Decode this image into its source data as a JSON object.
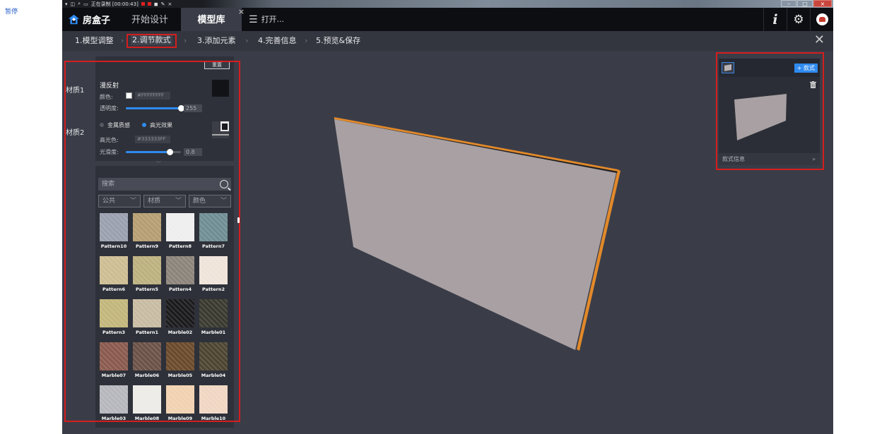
{
  "recorder": {
    "pause_label": "暂停",
    "status": "正在录制 [00:00:43]"
  },
  "app": {
    "logo_text": "房盒子",
    "tabs": [
      {
        "label": "开始设计"
      },
      {
        "label": "模型库"
      }
    ],
    "open_label": "打开..."
  },
  "steps": [
    {
      "label": "1.模型调整"
    },
    {
      "label": "2.调节款式"
    },
    {
      "label": "3.添加元素"
    },
    {
      "label": "4.完善信息"
    },
    {
      "label": "5.预览&保存"
    }
  ],
  "material_tabs": [
    "材质1",
    "材质2"
  ],
  "panel": {
    "reset_label": "重置",
    "diffuse_title": "漫反射",
    "color_label": "颜色:",
    "color_value": "#FFFFFFFF",
    "opacity_label": "透明度:",
    "opacity_value": "255",
    "opacity_fraction": 1.0,
    "metal_label": "金属质感",
    "gloss_label": "高光效果",
    "specular_label": "高光色:",
    "specular_value": "#333333FF",
    "smooth_label": "光滑度:",
    "smooth_value": "0.8",
    "smooth_fraction": 0.8,
    "search_placeholder": "搜索",
    "filters": [
      "公共",
      "材质",
      "颜色"
    ]
  },
  "materials": [
    {
      "label": "Pattern10",
      "color": "#9aa0ad"
    },
    {
      "label": "Pattern9",
      "color": "#b59d72"
    },
    {
      "label": "Pattern8",
      "color": "#eeeeee"
    },
    {
      "label": "Pattern7",
      "color": "#6f8d94"
    },
    {
      "label": "Pattern6",
      "color": "#cdbd92"
    },
    {
      "label": "Pattern5",
      "color": "#bcb07f"
    },
    {
      "label": "Pattern4",
      "color": "#8c847b"
    },
    {
      "label": "Pattern2",
      "color": "#efe4da"
    },
    {
      "label": "Pattern3",
      "color": "#c2b67b"
    },
    {
      "label": "Pattern1",
      "color": "#c8bba3"
    },
    {
      "label": "Marble02",
      "color": "#1b1b1e"
    },
    {
      "label": "Marble01",
      "color": "#3b3a30"
    },
    {
      "label": "Marble07",
      "color": "#8a5a4e"
    },
    {
      "label": "Marble06",
      "color": "#6b5248"
    },
    {
      "label": "Marble05",
      "color": "#6b4a2b"
    },
    {
      "label": "Marble04",
      "color": "#4d4531"
    },
    {
      "label": "Marble03",
      "color": "#b5b7bd"
    },
    {
      "label": "Marble08",
      "color": "#ecebe6"
    },
    {
      "label": "Marble09",
      "color": "#f1d2b0"
    },
    {
      "label": "Marble10",
      "color": "#f0d6c3"
    }
  ],
  "style_panel": {
    "add_label": "+ 款式",
    "info_label": "款式信息"
  },
  "colors": {
    "accent": "#2f8bf0",
    "highlight": "#d41e1e",
    "wall": "#a8a0a3",
    "wall_edge": "#e2892a"
  }
}
